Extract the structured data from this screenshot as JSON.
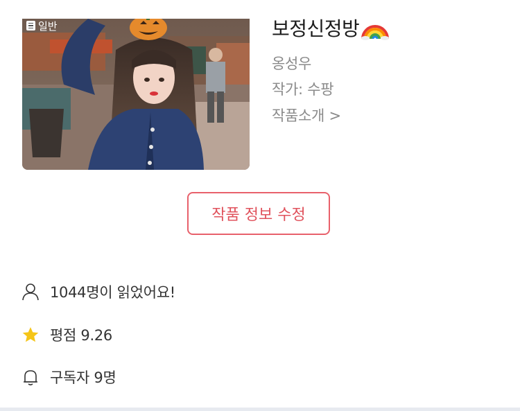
{
  "cover": {
    "badge_label": "일반",
    "badge_icon": "document-icon"
  },
  "work": {
    "title": "보정신정방",
    "title_emoji_icon": "rainbow-icon",
    "author_name": "옹성우",
    "writer_label": "작가: 수팡",
    "intro_link": "작품소개 >"
  },
  "actions": {
    "edit_label": "작품 정보 수정"
  },
  "stats": {
    "readers": "1044명이 읽었어요!",
    "rating": "평점 9.26",
    "subscribers": "구독자 9명"
  },
  "colors": {
    "accent": "#e8606b",
    "star": "#f5c518"
  }
}
